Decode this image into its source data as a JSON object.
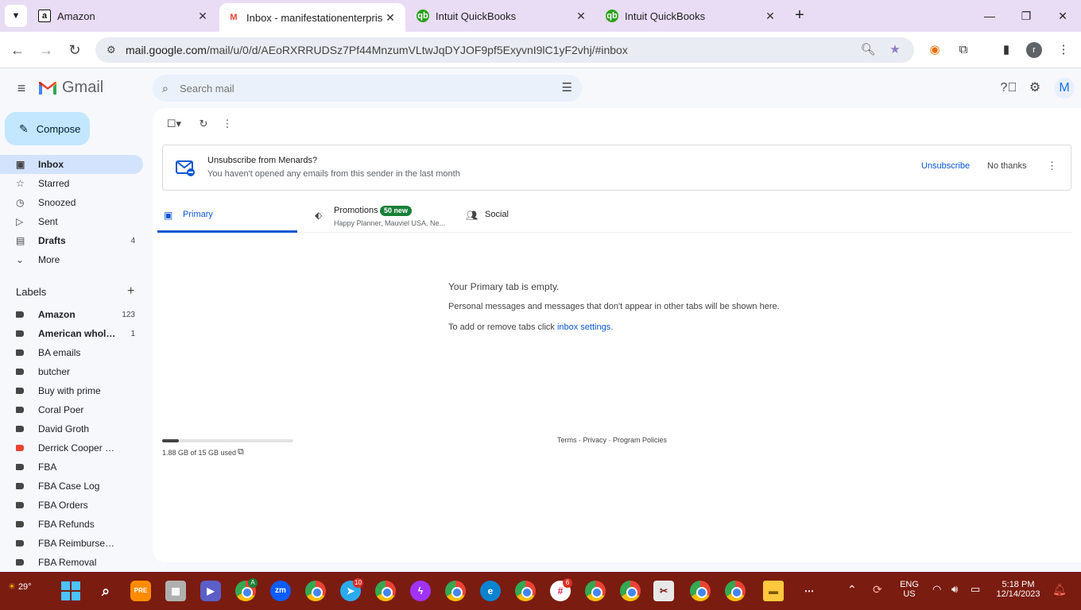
{
  "browser": {
    "tabs": [
      {
        "title": "Amazon",
        "icon": "amazon-icon",
        "active": false
      },
      {
        "title": "Inbox - manifestationenterprise",
        "icon": "gmail-icon",
        "active": true
      },
      {
        "title": "Intuit QuickBooks",
        "icon": "quickbooks-icon",
        "active": false
      },
      {
        "title": "Intuit QuickBooks",
        "icon": "quickbooks-icon",
        "active": false
      }
    ],
    "url_host": "mail.google.com",
    "url_path": "/mail/u/0/d/AEoRXRRUDSz7Pf44MnzumVLtwJqDYJOF9pf5ExyvnI9lC1yF2vhj/#inbox",
    "profile_initial": "r"
  },
  "gmail": {
    "brand": "Gmail",
    "search_placeholder": "Search mail",
    "account_initial": "M",
    "compose_label": "Compose",
    "nav": [
      {
        "label": "Inbox",
        "icon": "inbox-icon",
        "count": "",
        "active": true,
        "bold": true
      },
      {
        "label": "Starred",
        "icon": "star-icon",
        "count": "",
        "active": false,
        "bold": false
      },
      {
        "label": "Snoozed",
        "icon": "clock-icon",
        "count": "",
        "active": false,
        "bold": false
      },
      {
        "label": "Sent",
        "icon": "send-icon",
        "count": "",
        "active": false,
        "bold": false
      },
      {
        "label": "Drafts",
        "icon": "draft-icon",
        "count": "4",
        "active": false,
        "bold": true
      },
      {
        "label": "More",
        "icon": "chevron-down-icon",
        "count": "",
        "active": false,
        "bold": false
      }
    ],
    "labels_heading": "Labels",
    "labels": [
      {
        "name": "Amazon",
        "count": "123",
        "bold": true,
        "color": "#444746"
      },
      {
        "name": "American wholesal...",
        "count": "1",
        "bold": true,
        "color": "#444746"
      },
      {
        "name": "BA emails",
        "count": "",
        "bold": false,
        "color": "#444746"
      },
      {
        "name": "butcher",
        "count": "",
        "bold": false,
        "color": "#444746"
      },
      {
        "name": "Buy with prime",
        "count": "",
        "bold": false,
        "color": "#444746"
      },
      {
        "name": "Coral Poer",
        "count": "",
        "bold": false,
        "color": "#444746"
      },
      {
        "name": "David Groth",
        "count": "",
        "bold": false,
        "color": "#444746"
      },
      {
        "name": "Derrick Cooper dox",
        "count": "",
        "bold": false,
        "color": "#ea4335"
      },
      {
        "name": "FBA",
        "count": "",
        "bold": false,
        "color": "#444746"
      },
      {
        "name": "FBA Case Log",
        "count": "",
        "bold": false,
        "color": "#444746"
      },
      {
        "name": "FBA Orders",
        "count": "",
        "bold": false,
        "color": "#444746"
      },
      {
        "name": "FBA Refunds",
        "count": "",
        "bold": false,
        "color": "#444746"
      },
      {
        "name": "FBA Reimbursement",
        "count": "",
        "bold": false,
        "color": "#444746"
      },
      {
        "name": "FBA Removal",
        "count": "",
        "bold": false,
        "color": "#444746"
      }
    ],
    "banner": {
      "title": "Unsubscribe from Menards?",
      "subtitle": "You haven't opened any emails from this sender in the last month",
      "unsubscribe_label": "Unsubscribe",
      "no_thanks_label": "No thanks"
    },
    "category_tabs": {
      "primary": "Primary",
      "promotions": "Promotions",
      "promotions_badge": "50 new",
      "promotions_snippet": "Happy Planner, Mauviel USA, Ne...",
      "social": "Social"
    },
    "empty_state": {
      "title": "Your Primary tab is empty.",
      "subtitle": "Personal messages and messages that don't appear in other tabs will be shown here.",
      "settings_prefix": "To add or remove tabs click ",
      "settings_link": "inbox settings",
      "settings_suffix": "."
    },
    "storage": {
      "text": "1.88 GB of 15 GB used",
      "used_fraction": 0.125
    },
    "footer": "Terms · Privacy · Program Policies"
  },
  "taskbar": {
    "weather_temp": "29°",
    "language_top": "ENG",
    "language_bottom": "US",
    "time": "5:18 PM",
    "date": "12/14/2023",
    "badges": {
      "telegram": "10",
      "slack": "6"
    }
  },
  "colors": {
    "taskbar": "#7b1c10",
    "tab_strip": "#e9ddf6",
    "compose": "#c2e7ff",
    "active_nav": "#d3e3fd",
    "accent_blue": "#0b57d0",
    "promo_badge": "#188038"
  }
}
